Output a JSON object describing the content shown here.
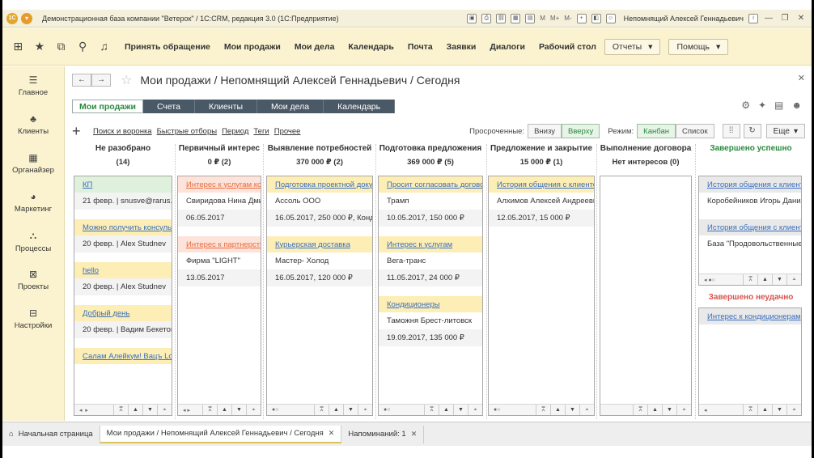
{
  "titlebar": {
    "logo": "1С",
    "title": "Демонстрационная база компании \"Ветерок\" / 1С:CRM, редакция 3.0  (1С:Предприятие)",
    "m_labels": [
      "M",
      "M+",
      "M-"
    ],
    "user": "Непомнящий Алексей Геннадьевич"
  },
  "topnav": {
    "links": [
      "Принять обращение",
      "Мои продажи",
      "Мои дела",
      "Календарь",
      "Почта",
      "Заявки",
      "Диалоги",
      "Рабочий стол"
    ],
    "reports": "Отчеты",
    "help": "Помощь"
  },
  "sidebar": {
    "items": [
      {
        "label": "Главное",
        "icon": "menu-icon"
      },
      {
        "label": "Клиенты",
        "icon": "clients-icon"
      },
      {
        "label": "Органайзер",
        "icon": "calendar-icon"
      },
      {
        "label": "Маркетинг",
        "icon": "pie-chart-icon"
      },
      {
        "label": "Процессы",
        "icon": "process-icon"
      },
      {
        "label": "Проекты",
        "icon": "project-icon"
      },
      {
        "label": "Настройки",
        "icon": "settings-icon"
      }
    ]
  },
  "page": {
    "title": "Мои продажи / Непомнящий Алексей Геннадьевич / Сегодня"
  },
  "tabs": [
    "Мои продажи",
    "Счета",
    "Клиенты",
    "Мои дела",
    "Календарь"
  ],
  "toolbar": {
    "links": [
      "Поиск и воронка",
      "Быстрые отборы",
      "Период",
      "Теги",
      "Прочее"
    ],
    "overdue_label": "Просроченные:",
    "overdue_opts": [
      "Внизу",
      "Вверху"
    ],
    "mode_label": "Режим:",
    "mode_opts": [
      "Канбан",
      "Список"
    ],
    "more": "Еще"
  },
  "columns": [
    {
      "title": "Не разобрано",
      "sum": "(14)",
      "cards": [
        {
          "title": "КП",
          "color": "green",
          "line": "21 февр. | snusve@rarus.ru"
        },
        {
          "title": "Можно получить консультацию",
          "color": "yellow",
          "line": "20 февр. | Alex Studnev"
        },
        {
          "title": "hello",
          "color": "yellow",
          "line": "20 февр. | Alex Studnev"
        },
        {
          "title": "Добрый день",
          "color": "yellow",
          "line": "20 февр. | Вадим Бекетов"
        },
        {
          "title": "Салам Алейкум! Вацъ Lo",
          "color": "yellow",
          "line": ""
        }
      ]
    },
    {
      "title": "Первичный интерес",
      "sum": "0 ₽ (2)",
      "cards": [
        {
          "title": "Интерес к услугам компании",
          "color": "pink",
          "line": "Свиридова Нина Дмитриевна",
          "line2": "06.05.2017"
        },
        {
          "title": "Интерес к партнерству",
          "color": "pink",
          "line": "Фирма \"LIGHT\"",
          "line2": "13.05.2017"
        }
      ]
    },
    {
      "title": "Выявление потребностей",
      "sum": "370 000 ₽ (2)",
      "cards": [
        {
          "title": "Подготовка проектной документации",
          "color": "yellow",
          "line": "Ассоль ООО",
          "line2": "16.05.2017, 250 000 ₽, Конд"
        },
        {
          "title": "Курьерская доставка",
          "color": "yellow",
          "line": "Мастер- Холод",
          "line2": "16.05.2017, 120 000 ₽"
        }
      ]
    },
    {
      "title": "Подготовка предложения",
      "sum": "369 000 ₽ (5)",
      "cards": [
        {
          "title": "Просит согласовать договор",
          "color": "yellow",
          "line": "Трамп",
          "line2": "10.05.2017, 150 000 ₽"
        },
        {
          "title": "Интерес к услугам",
          "color": "yellow",
          "line": "Вега-транс",
          "line2": "11.05.2017, 24 000 ₽"
        },
        {
          "title": "Кондиционеры",
          "color": "yellow",
          "line": "Таможня Брест-литовск",
          "line2": "19.09.2017, 135 000 ₽"
        }
      ]
    },
    {
      "title": "Предложение и закрытие",
      "sum": "15 000 ₽ (1)",
      "cards": [
        {
          "title": "История общения с клиентом",
          "color": "yellow",
          "line": "Алхимов Алексей Андреевич",
          "line2": "12.05.2017, 15 000 ₽"
        }
      ]
    },
    {
      "title": "Выполнение договора",
      "sum": "Нет интересов (0)",
      "cards": []
    }
  ],
  "won": {
    "title": "Завершено успешно",
    "cards": [
      {
        "title": "История общения с клиентом",
        "line": "Коробейников Игорь Данилович"
      },
      {
        "title": "История общения с клиентом",
        "line": "База \"Продовольственные товары\""
      }
    ]
  },
  "lost": {
    "title": "Завершено неудачно",
    "cards": [
      {
        "title": "Интерес к кондиционерам"
      }
    ]
  },
  "bottom": {
    "home": "Начальная страница",
    "active": "Мои продажи / Непомнящий Алексей Геннадьевич / Сегодня",
    "reminders": "Напоминаний: 1"
  }
}
